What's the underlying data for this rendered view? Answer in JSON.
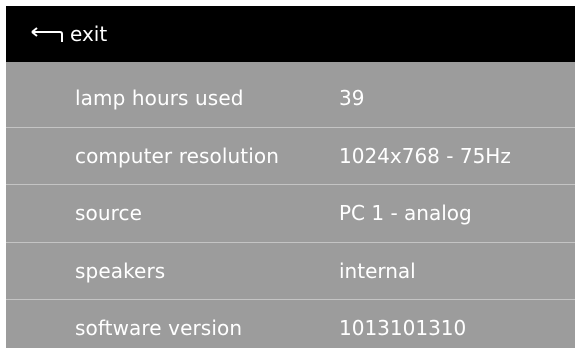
{
  "header": {
    "exit_label": "exit",
    "icon": "return-arrow-icon"
  },
  "rows": [
    {
      "label": "lamp hours used",
      "value": "39"
    },
    {
      "label": "computer resolution",
      "value": "1024x768 - 75Hz"
    },
    {
      "label": "source",
      "value": "PC 1 - analog"
    },
    {
      "label": "speakers",
      "value": "internal"
    },
    {
      "label": "software version",
      "value": "1013101310"
    }
  ],
  "colors": {
    "header_background": "#000000",
    "panel_background": "#9c9c9c",
    "divider": "#c4c4c4",
    "text": "#ffffff"
  }
}
